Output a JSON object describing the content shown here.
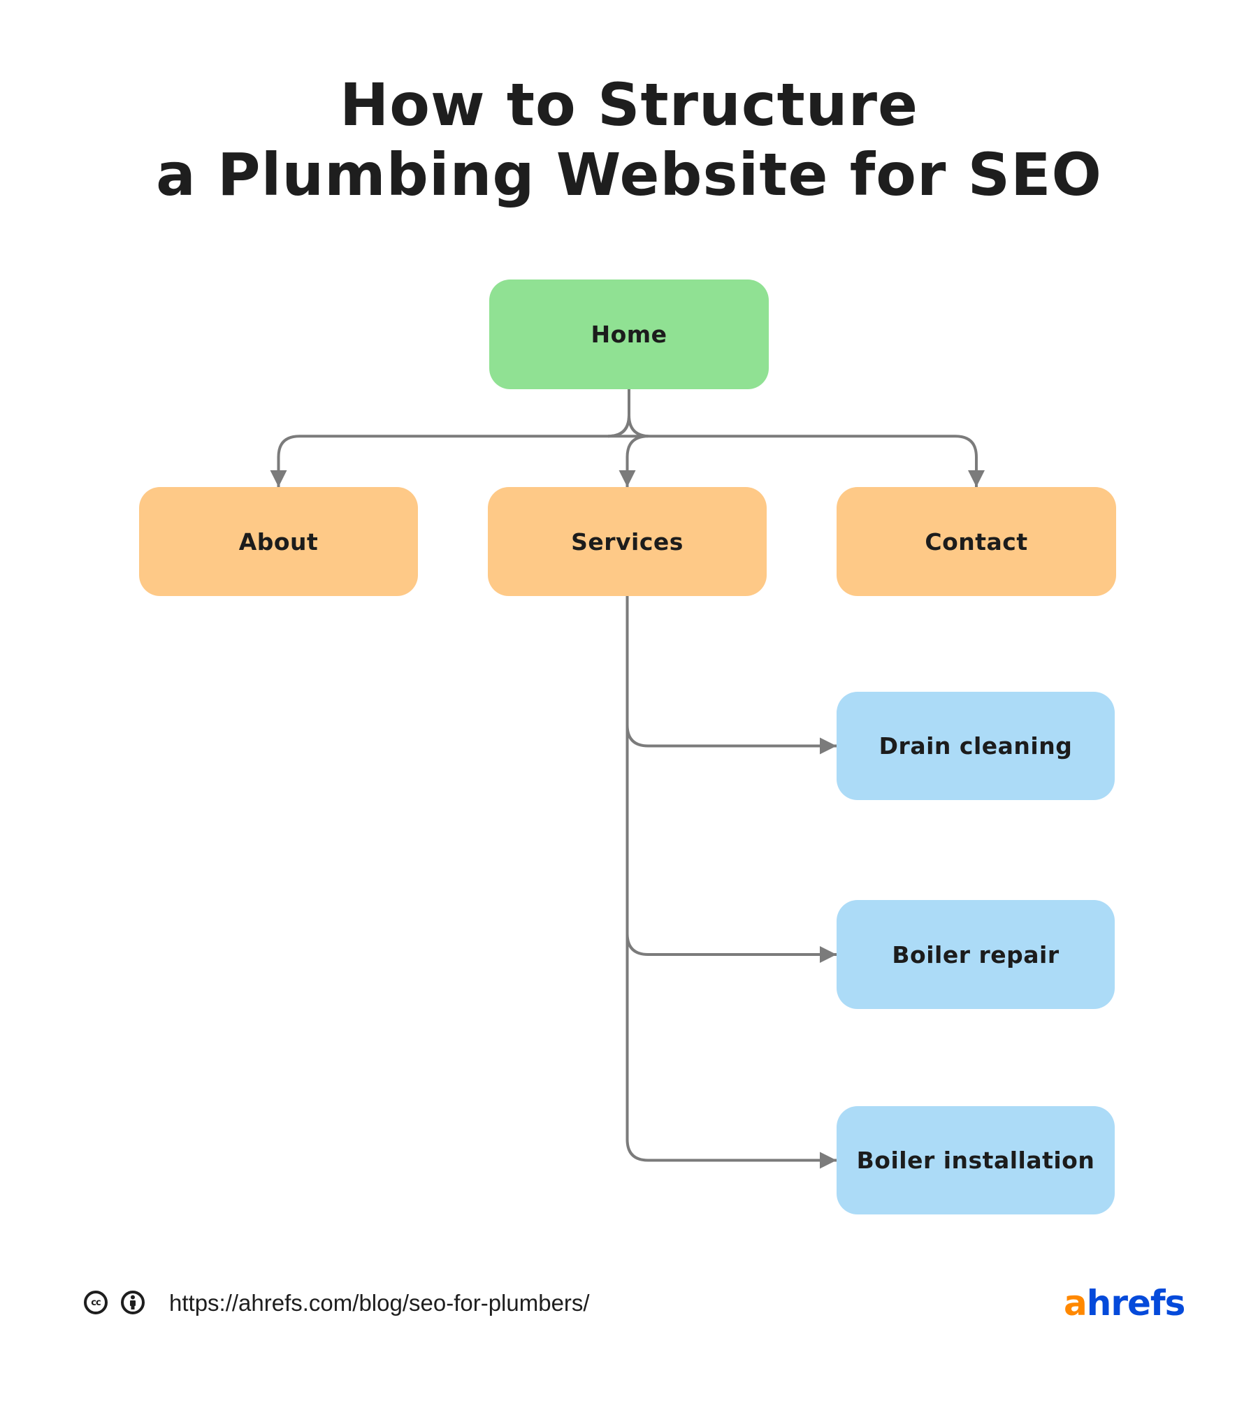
{
  "title": {
    "line1": "How to Structure",
    "line2": "a Plumbing Website for SEO"
  },
  "diagram": {
    "root": {
      "id": "home",
      "label": "Home",
      "level": "root"
    },
    "level1": [
      {
        "id": "about",
        "label": "About",
        "level": "section"
      },
      {
        "id": "services",
        "label": "Services",
        "level": "section"
      },
      {
        "id": "contact",
        "label": "Contact",
        "level": "section"
      }
    ],
    "services_children": [
      {
        "id": "drain-cleaning",
        "label": "Drain cleaning",
        "level": "service"
      },
      {
        "id": "boiler-repair",
        "label": "Boiler repair",
        "level": "service"
      },
      {
        "id": "boiler-installation",
        "label": "Boiler installation",
        "level": "service"
      }
    ],
    "edges": [
      [
        "home",
        "about"
      ],
      [
        "home",
        "services"
      ],
      [
        "home",
        "contact"
      ],
      [
        "services",
        "drain-cleaning"
      ],
      [
        "services",
        "boiler-repair"
      ],
      [
        "services",
        "boiler-installation"
      ]
    ],
    "colors": {
      "root": "#90e193",
      "section": "#fec987",
      "service": "#acdbf7",
      "connector": "#7b7b7b"
    }
  },
  "footer": {
    "license_icons": [
      "creative-commons-icon",
      "attribution-icon"
    ],
    "cc_label": "cc",
    "url": "https://ahrefs.com/blog/seo-for-plumbers/",
    "logo": {
      "part1": "a",
      "part2": "hrefs",
      "color1": "#ff8800",
      "color2": "#054ada"
    }
  }
}
